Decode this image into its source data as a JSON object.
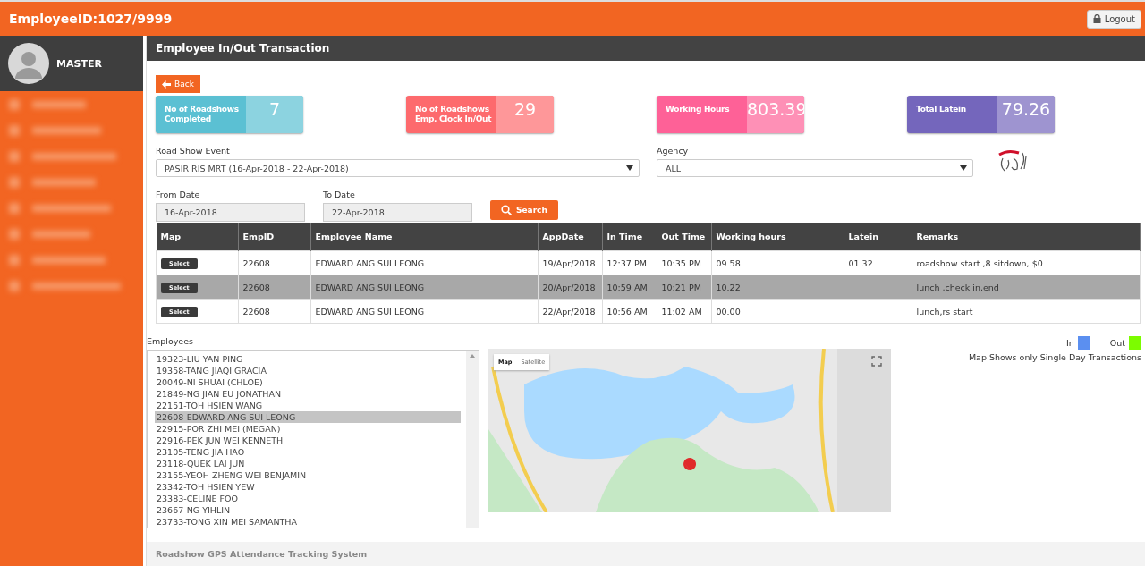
{
  "header": {
    "title": "EmployeeID:1027/9999",
    "logout": "Logout"
  },
  "sidebar": {
    "user": "MASTER"
  },
  "page": {
    "title": "Employee In/Out Transaction",
    "back": "Back"
  },
  "stats": [
    {
      "label": "No of Roadshows Completed",
      "value": "7",
      "color": "#5bc0d3"
    },
    {
      "label": "No of Roadshows Emp. Clock In/Out",
      "value": "29",
      "color": "#fd6a6d"
    },
    {
      "label": "Working Hours",
      "value": "803.39",
      "color": "#fe6197"
    },
    {
      "label": "Total Latein",
      "value": "79.26",
      "color": "#7466bc"
    }
  ],
  "filters": {
    "event_label": "Road Show Event",
    "event_value": "PASIR RIS MRT (16-Apr-2018 - 22-Apr-2018)",
    "agency_label": "Agency",
    "agency_value": "ALL",
    "from_label": "From Date",
    "from_value": "16-Apr-2018",
    "to_label": "To Date",
    "to_value": "22-Apr-2018",
    "search": "Search"
  },
  "table": {
    "columns": [
      "Map",
      "EmpID",
      "Employee Name",
      "AppDate",
      "In Time",
      "Out Time",
      "Working hours",
      "Latein",
      "Remarks"
    ],
    "rows": [
      {
        "selected": false,
        "cells": [
          "Select",
          "22608",
          "EDWARD ANG SUI LEONG",
          "19/Apr/2018",
          "12:37 PM",
          "10:35 PM",
          "09.58",
          "01.32",
          "roadshow start ,8 sitdown, $0"
        ]
      },
      {
        "selected": true,
        "cells": [
          "Select",
          "22608",
          "EDWARD ANG SUI LEONG",
          "20/Apr/2018",
          "10:59 AM",
          "10:21 PM",
          "10.22",
          "",
          "lunch ,check in,end"
        ]
      },
      {
        "selected": false,
        "cells": [
          "Select",
          "22608",
          "EDWARD ANG SUI LEONG",
          "22/Apr/2018",
          "10:56 AM",
          "11:02 AM",
          "00.00",
          "",
          "lunch,rs start"
        ]
      }
    ]
  },
  "employees": {
    "label": "Employees",
    "items": [
      {
        "text": "19323-LIU YAN PING",
        "selected": false
      },
      {
        "text": "19358-TANG JIAQI GRACIA",
        "selected": false
      },
      {
        "text": "20049-NI SHUAI (CHLOE)",
        "selected": false
      },
      {
        "text": "21849-NG JIAN EU JONATHAN",
        "selected": false
      },
      {
        "text": "22151-TOH HSIEN WANG",
        "selected": false
      },
      {
        "text": "22608-EDWARD ANG SUI LEONG",
        "selected": true
      },
      {
        "text": "22915-POR ZHI MEI (MEGAN)",
        "selected": false
      },
      {
        "text": "22916-PEK JUN WEI KENNETH",
        "selected": false
      },
      {
        "text": "23105-TENG JIA HAO",
        "selected": false
      },
      {
        "text": "23118-QUEK LAI JUN",
        "selected": false
      },
      {
        "text": "23155-YEOH ZHENG WEI BENJAMIN",
        "selected": false
      },
      {
        "text": "23342-TOH HSIEN YEW",
        "selected": false
      },
      {
        "text": "23383-CELINE FOO",
        "selected": false
      },
      {
        "text": "23667-NG YIHLIN",
        "selected": false
      },
      {
        "text": "23733-TONG XIN MEI SAMANTHA",
        "selected": false
      }
    ]
  },
  "map": {
    "tabs": [
      {
        "label": "Map",
        "selected": true
      },
      {
        "label": "Satellite",
        "selected": false
      }
    ]
  },
  "legend": {
    "items": [
      {
        "label": "In",
        "color": "#5b8ff0"
      },
      {
        "label": "Out",
        "color": "#7cfc00"
      }
    ],
    "note": "Map Shows only Single Day Transactions"
  },
  "footer": {
    "text": "Roadshow GPS Attendance Tracking System"
  }
}
